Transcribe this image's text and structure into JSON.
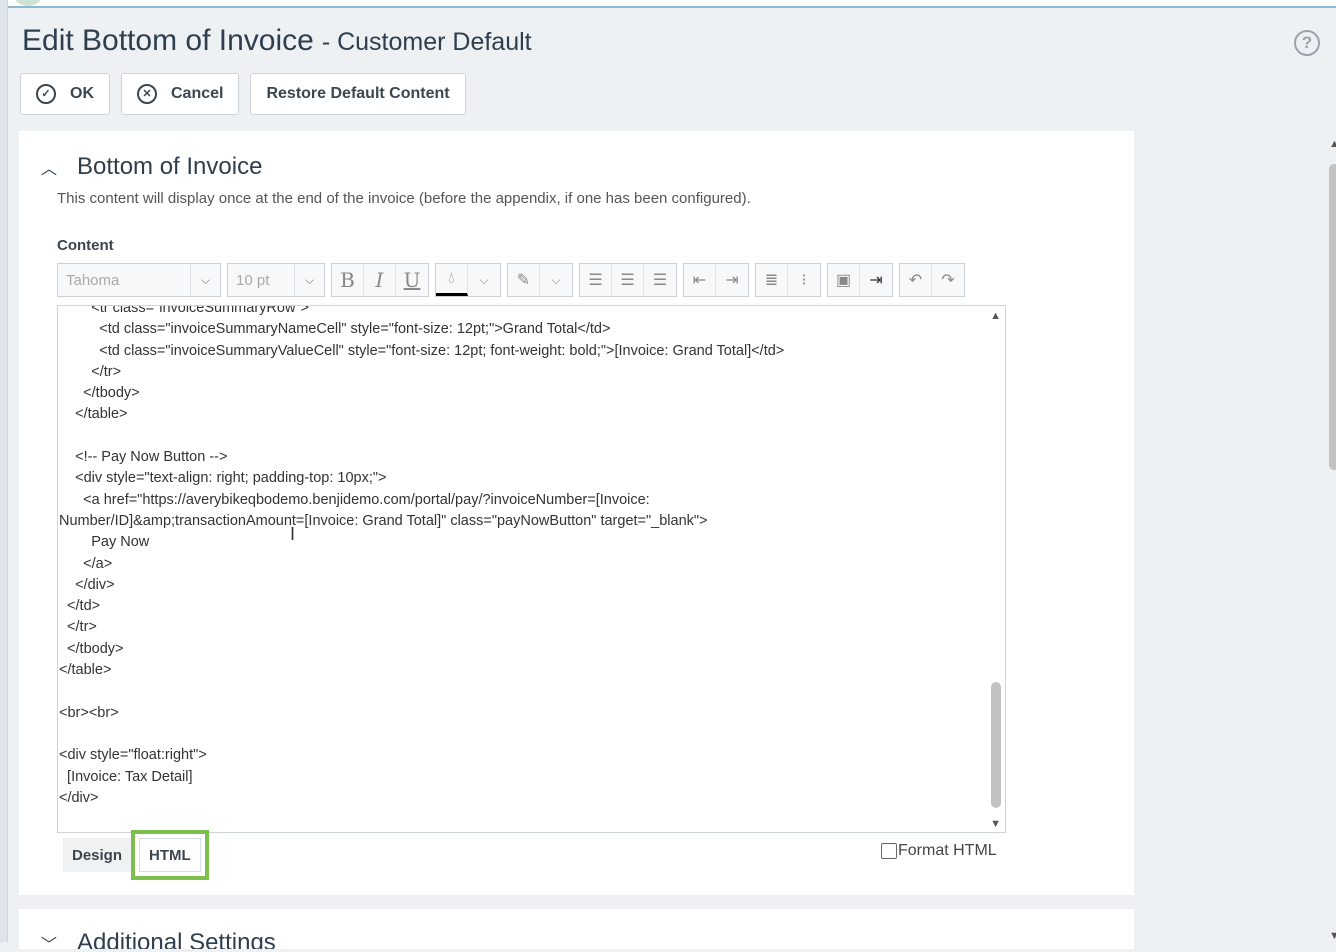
{
  "page": {
    "title": "Edit Bottom of Invoice",
    "subtitle": "- Customer Default"
  },
  "buttons": {
    "ok": "OK",
    "cancel": "Cancel",
    "restore": "Restore Default Content"
  },
  "section": {
    "title": "Bottom of Invoice",
    "description": "This content will display once at the end of the invoice (before the appendix, if one has been configured).",
    "content_label": "Content"
  },
  "toolbar": {
    "font": "Tahoma",
    "size": "10 pt",
    "bold": "B",
    "italic": "I",
    "underline": "U"
  },
  "editor": {
    "lines": [
      "        <tr class=\"invoiceSummaryRow\">",
      "          <td class=\"invoiceSummaryNameCell\" style=\"font-size: 12pt;\">Grand Total</td>",
      "          <td class=\"invoiceSummaryValueCell\" style=\"font-size: 12pt; font-weight: bold;\">[Invoice: Grand Total]</td>",
      "        </tr>",
      "      </tbody>",
      "    </table>",
      "",
      "    <!-- Pay Now Button -->",
      "    <div style=\"text-align: right; padding-top: 10px;\">",
      "      <a href=\"https://averybikeqbodemo.benjidemo.com/portal/pay/?invoiceNumber=[Invoice:",
      "Number/ID]&amp;transactionAmount=[Invoice: Grand Total]\" class=\"payNowButton\" target=\"_blank\">",
      "        Pay Now",
      "      </a>",
      "    </div>",
      "  </td>",
      "  </tr>",
      "  </tbody>",
      "</table>",
      "",
      "<br><br>",
      "",
      "<div style=\"float:right\">",
      "  [Invoice: Tax Detail]",
      "</div>"
    ]
  },
  "tabs": {
    "design": "Design",
    "html": "HTML"
  },
  "format_html": "Format HTML",
  "next_section": "Additional Settings",
  "colors": {
    "highlight": "#7cc04b",
    "title": "#2f3e4e"
  }
}
